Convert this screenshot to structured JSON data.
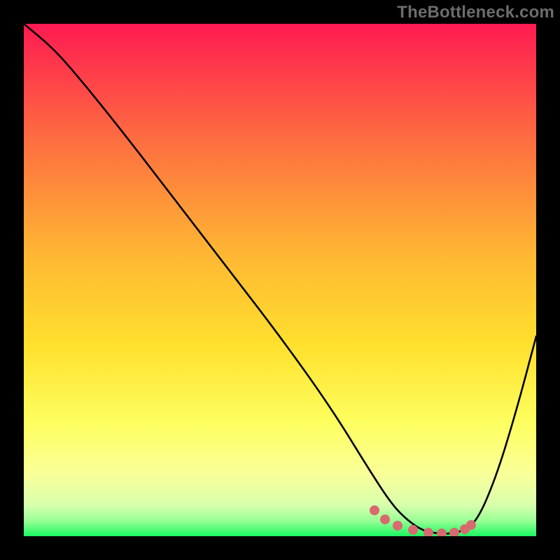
{
  "watermark": "TheBottleneck.com",
  "colors": {
    "top": "#ff1a52",
    "mid_upper": "#fd7a3e",
    "mid": "#ffd22e",
    "mid_lower": "#feff60",
    "low": "#f3ffb7",
    "bottom": "#19f762",
    "curve": "#000000",
    "dot": "#d86a6f",
    "frame": "#000000"
  },
  "chart_data": {
    "type": "line",
    "title": "",
    "xlabel": "",
    "ylabel": "",
    "xlim": [
      0,
      100
    ],
    "ylim": [
      0,
      100
    ],
    "series": [
      {
        "name": "bottleneck-curve",
        "x": [
          0,
          6,
          12,
          20,
          30,
          40,
          50,
          60,
          68,
          72,
          75,
          78,
          81,
          84,
          88,
          92,
          96,
          100
        ],
        "values": [
          100,
          95,
          88,
          78,
          65,
          52,
          39,
          25,
          12,
          6,
          3,
          1,
          0.5,
          0.5,
          2,
          11,
          24,
          39
        ]
      }
    ],
    "flat_region_x": [
      68.5,
      87
    ],
    "dots": [
      {
        "x": 68.5,
        "y": 5.0
      },
      {
        "x": 70.5,
        "y": 3.3
      },
      {
        "x": 73.0,
        "y": 2.1
      },
      {
        "x": 76.0,
        "y": 1.2
      },
      {
        "x": 79.0,
        "y": 0.7
      },
      {
        "x": 81.5,
        "y": 0.5
      },
      {
        "x": 84.0,
        "y": 0.7
      },
      {
        "x": 86.0,
        "y": 1.4
      },
      {
        "x": 87.3,
        "y": 2.2
      }
    ],
    "annotations": []
  }
}
